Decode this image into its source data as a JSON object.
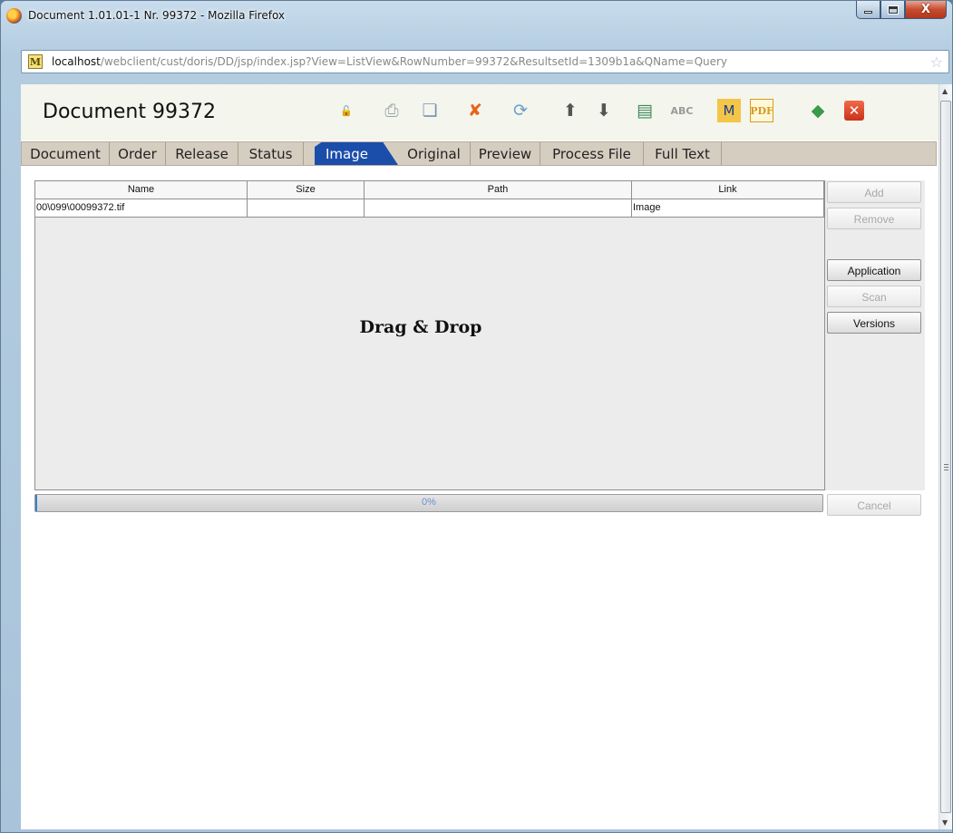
{
  "window": {
    "title": "Document 1.01.01-1 Nr. 99372 - Mozilla Firefox",
    "minimize_icon": "minimize-icon",
    "maximize_icon": "maximize-icon",
    "close_icon": "close-window-icon",
    "close_glyph": "X"
  },
  "urlbar": {
    "site_icon_letter": "M",
    "host": "localhost",
    "path": "/webclient/cust/doris/DD/jsp/index.jsp?View=ListView&RowNumber=99372&ResultsetId=1309b1a&QName=Query",
    "bookmark_icon": "star-icon"
  },
  "header": {
    "title": "Document  99372",
    "toolbar_icons": [
      {
        "name": "unlock-icon",
        "glyph": "🔓",
        "color": "#e0a020"
      },
      {
        "name": "print-icon",
        "glyph": "⎙",
        "color": "#9aa4a8"
      },
      {
        "name": "copy-document-icon",
        "glyph": "❏",
        "color": "#7a8fb8"
      },
      {
        "name": "delete-icon",
        "glyph": "✘",
        "color": "#e8621a"
      },
      {
        "name": "refresh-icon",
        "glyph": "⟳",
        "color": "#6aa0d0"
      },
      {
        "name": "arrow-up-icon",
        "glyph": "⬆",
        "color": "#555555"
      },
      {
        "name": "arrow-down-icon",
        "glyph": "⬇",
        "color": "#555555"
      },
      {
        "name": "spreadsheet-icon",
        "glyph": "▤",
        "color": "#3c8c5a"
      },
      {
        "name": "spellcheck-icon",
        "glyph": "ABC",
        "color": "#9a9a9a"
      },
      {
        "name": "mail-merge-icon",
        "glyph": "M",
        "color": "#d89a20"
      },
      {
        "name": "pdf-icon",
        "glyph": "PDF",
        "color": "#d89a20"
      },
      {
        "name": "apply-icon",
        "glyph": "◆",
        "color": "#3a9a4a"
      },
      {
        "name": "close-icon",
        "glyph": "✕",
        "color": "#ffffff"
      }
    ]
  },
  "tabs": [
    {
      "label": "Document",
      "active": false
    },
    {
      "label": "Order",
      "active": false
    },
    {
      "label": "Release",
      "active": false
    },
    {
      "label": "Status",
      "active": false
    },
    {
      "label": "Image",
      "active": true
    },
    {
      "label": "Original",
      "active": false
    },
    {
      "label": "Preview",
      "active": false
    },
    {
      "label": "Process File",
      "active": false
    },
    {
      "label": "Full Text",
      "active": false
    }
  ],
  "files_table": {
    "columns": [
      "Name",
      "Size",
      "Path",
      "Link"
    ],
    "rows": [
      [
        "00\\099\\00099372.tif",
        "",
        "",
        "Image"
      ]
    ]
  },
  "drop_zone": {
    "text": "Drag & Drop"
  },
  "side_buttons": [
    {
      "label": "Add",
      "enabled": false
    },
    {
      "label": "Remove",
      "enabled": false
    },
    {
      "label": "Application",
      "enabled": true
    },
    {
      "label": "Scan",
      "enabled": false
    },
    {
      "label": "Versions",
      "enabled": true
    }
  ],
  "progress": {
    "value": 0.0,
    "text": "0%"
  },
  "cancel_button": {
    "label": "Cancel",
    "enabled": false
  }
}
